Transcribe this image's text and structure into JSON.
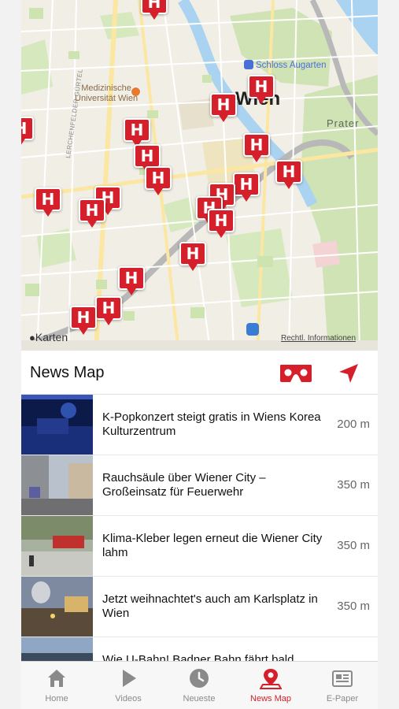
{
  "map": {
    "labels": {
      "medizinische": "Medizinische\nUniversität Wien",
      "augarten": "Schloss Augarten",
      "prater": "Prater",
      "wien": "Wien",
      "guertel": "LERCHENFELDER GÜRTEL",
      "karten": "Karten",
      "legal": "Rechtl. Informationen"
    },
    "pin_glyph": "H",
    "pin_color": "#d5202b"
  },
  "header": {
    "title": "News Map",
    "vr_icon": "vr-goggles-icon",
    "location_icon": "location-arrow-icon",
    "accent": "#d5202b"
  },
  "news": [
    {
      "headline": "K-Popkonzert steigt gratis in Wiens Korea Kulturzentrum",
      "distance": "200 m"
    },
    {
      "headline": "Rauchsäule über Wiener City – Großeinsatz für Feuerwehr",
      "distance": "350 m"
    },
    {
      "headline": "Klima-Kleber legen erneut die Wiener City lahm",
      "distance": "350 m"
    },
    {
      "headline": "Jetzt weihnachtet's auch am Karlsplatz in Wien",
      "distance": "350 m"
    },
    {
      "headline": "Wie U-Bahn! Badner Bahn fährt bald",
      "distance": ""
    }
  ],
  "tabs": [
    {
      "label": "Home",
      "icon": "home-icon"
    },
    {
      "label": "Videos",
      "icon": "play-icon"
    },
    {
      "label": "Neueste",
      "icon": "clock-icon"
    },
    {
      "label": "News Map",
      "icon": "map-pin-icon",
      "active": true
    },
    {
      "label": "E-Paper",
      "icon": "newspaper-icon"
    }
  ]
}
